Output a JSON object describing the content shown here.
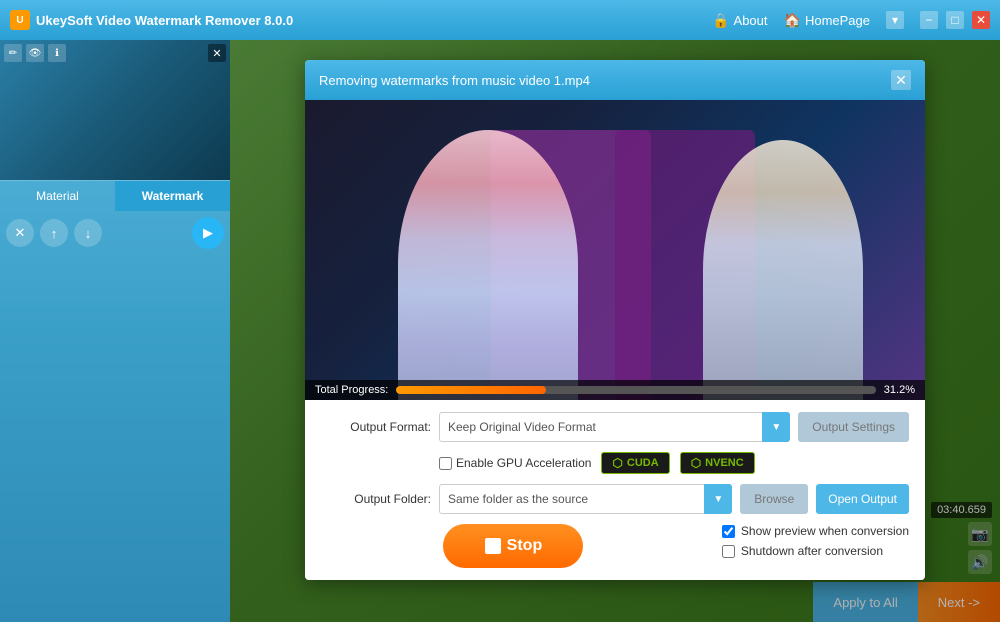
{
  "app": {
    "title": "UkeySoft Video Watermark Remover 8.0.0",
    "logo_text": "U"
  },
  "titlebar": {
    "about_label": "About",
    "homepage_label": "HomePage",
    "minimize_label": "−",
    "maximize_label": "□",
    "close_label": "✕",
    "dropdown_label": "▾"
  },
  "sidebar": {
    "material_tab": "Material",
    "watermark_tab": "Watermark",
    "delete_btn": "✕",
    "up_btn": "↑",
    "down_btn": "↓",
    "play_btn": "▶"
  },
  "dialog": {
    "title": "Removing watermarks from music video 1.mp4",
    "close_btn": "✕",
    "video_progress_label": "Total Progress:",
    "video_progress_pct": "31.2%",
    "output_format_label": "Output Format:",
    "output_format_value": "Keep Original Video Format",
    "output_settings_btn": "Output Settings",
    "enable_gpu_label": "Enable GPU Acceleration",
    "cuda_label": "CUDA",
    "nvenc_label": "NVENC",
    "output_folder_label": "Output Folder:",
    "output_folder_value": "Same folder as the source",
    "browse_btn": "Browse",
    "open_output_btn": "Open Output",
    "stop_btn": "Stop",
    "show_preview_label": "Show preview when conversion",
    "shutdown_label": "Shutdown after conversion"
  },
  "action_bar": {
    "apply_all_btn": "Apply to All",
    "next_btn": "Next ->"
  },
  "right_panel": {
    "time_display": "03:40.659"
  },
  "colors": {
    "accent_blue": "#4db8e8",
    "accent_orange": "#ff7820",
    "progress_orange": "#ff9020",
    "gpu_green": "#76b900"
  }
}
